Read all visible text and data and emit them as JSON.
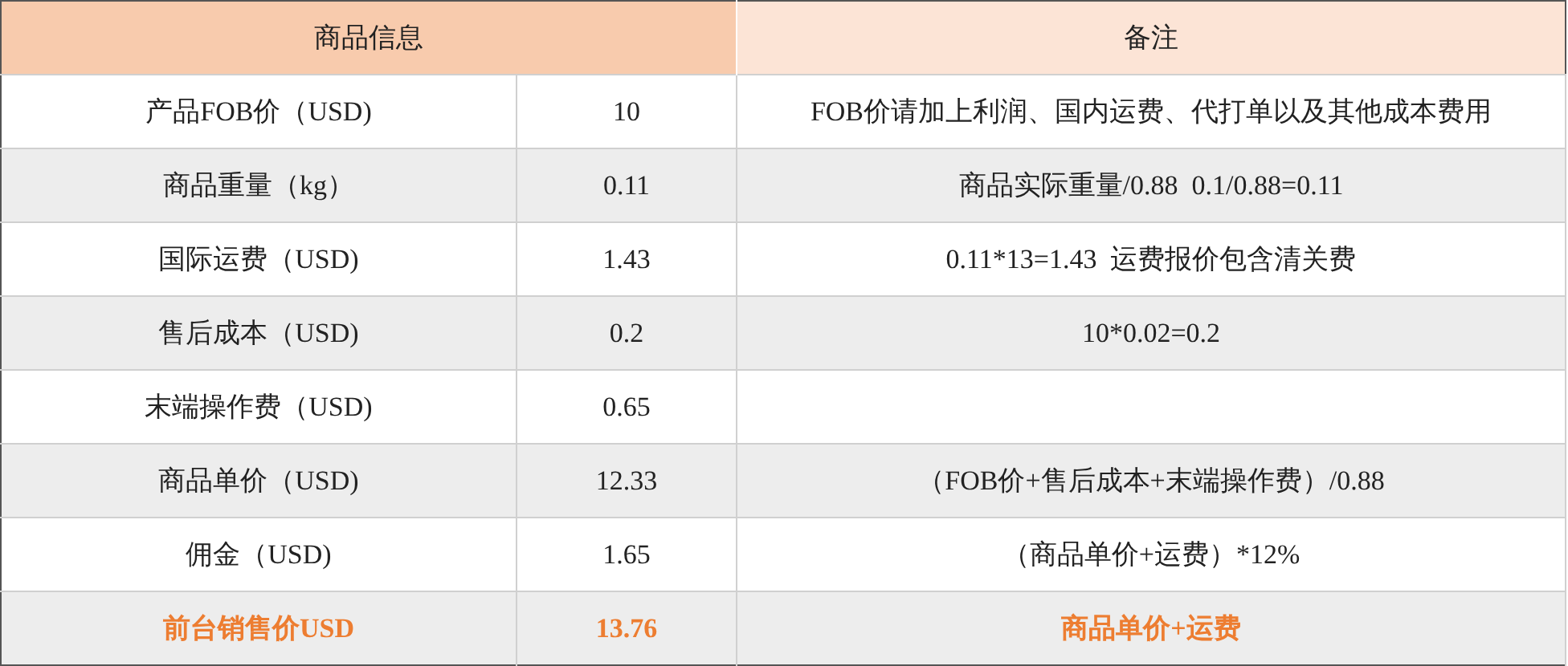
{
  "table": {
    "columns": [
      {
        "label": "商品信息"
      },
      {
        "label": "备注"
      }
    ],
    "rows": [
      {
        "kind": "normal",
        "label": "产品FOB价（USD)",
        "value": "10",
        "note": "FOB价请加上利润、国内运费、代打单以及其他成本费用"
      },
      {
        "kind": "normal",
        "label": "商品重量（kg）",
        "value": "0.11",
        "note": "商品实际重量/0.88  0.1/0.88=0.11"
      },
      {
        "kind": "normal",
        "label": "国际运费（USD)",
        "value": "1.43",
        "note": "0.11*13=1.43  运费报价包含清关费"
      },
      {
        "kind": "normal",
        "label": "售后成本（USD)",
        "value": "0.2",
        "note": "10*0.02=0.2"
      },
      {
        "kind": "normal",
        "label": "末端操作费（USD)",
        "value": "0.65"
      },
      {
        "kind": "normal",
        "label": "商品单价（USD)",
        "value": "12.33",
        "note": "（FOB价+售后成本+末端操作费）/0.88"
      },
      {
        "kind": "normal",
        "label": "佣金（USD)",
        "value": "1.65",
        "note": "（商品单价+运费）*12%"
      },
      {
        "kind": "total",
        "label": "前台销售价USD",
        "value": "13.76",
        "note": "商品单价+运费"
      }
    ]
  }
}
